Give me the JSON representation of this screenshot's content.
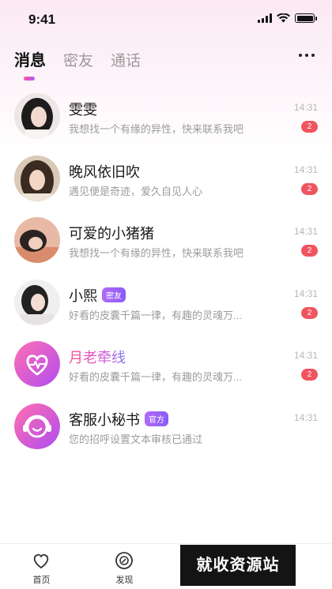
{
  "status_bar": {
    "time": "9:41"
  },
  "tabs": [
    {
      "label": "消息",
      "active": true
    },
    {
      "label": "密友",
      "active": false
    },
    {
      "label": "通话",
      "active": false
    }
  ],
  "more_icon": "more-horizontal-icon",
  "conversations": [
    {
      "name": "雯雯",
      "preview": "我想找一个有缘的异性，快来联系我吧",
      "time": "14:31",
      "unread": "2",
      "avatar": "photo"
    },
    {
      "name": "晚风依旧吹",
      "preview": "遇见便是奇迹，爱久自见人心",
      "time": "14:31",
      "unread": "2",
      "avatar": "photo"
    },
    {
      "name": "可爱的小猪猪",
      "preview": "我想找一个有缘的异性，快来联系我吧",
      "time": "14:31",
      "unread": "2",
      "avatar": "photo"
    },
    {
      "name": "小熙",
      "tag": "密友",
      "preview": "好看的皮囊千篇一律，有趣的灵魂万...",
      "time": "14:31",
      "unread": "2",
      "avatar": "photo"
    },
    {
      "name": "月老牵线",
      "preview": "好看的皮囊千篇一律，有趣的灵魂万...",
      "time": "14:31",
      "unread": "2",
      "avatar": "heart-pulse-icon"
    },
    {
      "name": "客服小秘书",
      "tag": "官方",
      "preview": "您的招呼设置文本审核已通过",
      "time": "14:31",
      "avatar": "headset-smile-icon"
    }
  ],
  "bottom_nav": [
    {
      "label": "首页",
      "icon": "heart-outline-icon"
    },
    {
      "label": "发现",
      "icon": "compass-icon"
    },
    {
      "label": "",
      "icon": ""
    },
    {
      "label": "",
      "icon": ""
    }
  ],
  "watermark": "就收资源站",
  "colors": {
    "accent_pink": "#ff4fa3",
    "accent_purple": "#b25cf2",
    "badge_red": "#f0555f"
  }
}
